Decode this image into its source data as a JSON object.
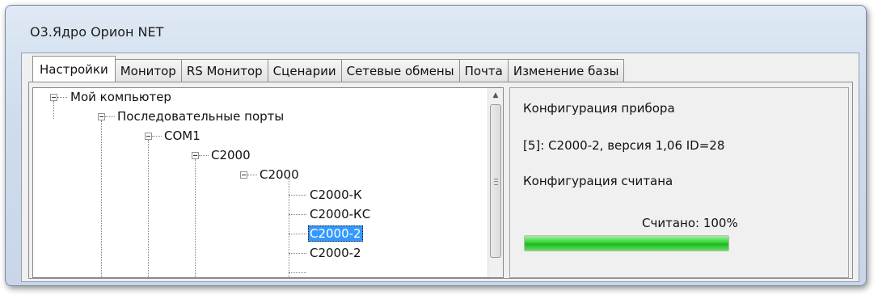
{
  "window": {
    "title": "О3.Ядро Орион NET"
  },
  "tabs": [
    {
      "label": "Настройки",
      "active": true
    },
    {
      "label": "Монитор"
    },
    {
      "label": "RS Монитор"
    },
    {
      "label": "Сценарии"
    },
    {
      "label": "Сетевые обмены"
    },
    {
      "label": "Почта"
    },
    {
      "label": "Изменение базы"
    }
  ],
  "tree": {
    "nodes": [
      {
        "label": "Мой компьютер"
      },
      {
        "label": "Последовательные порты"
      },
      {
        "label": "COM1"
      },
      {
        "label": "С2000"
      },
      {
        "label": "С2000"
      },
      {
        "label": "С2000-К"
      },
      {
        "label": "С2000-КС"
      },
      {
        "label": "С2000-2",
        "selected": true
      },
      {
        "label": "С2000-2"
      }
    ]
  },
  "info": {
    "heading": "Конфигурация прибора",
    "device": "[5]: С2000-2, версия 1,06 ID=28",
    "status": "Конфигурация считана",
    "progress_label": "Считано: 100%",
    "progress": 1.0
  },
  "colors": {
    "progress": "#2ec82e",
    "selection": "#3399ff"
  }
}
